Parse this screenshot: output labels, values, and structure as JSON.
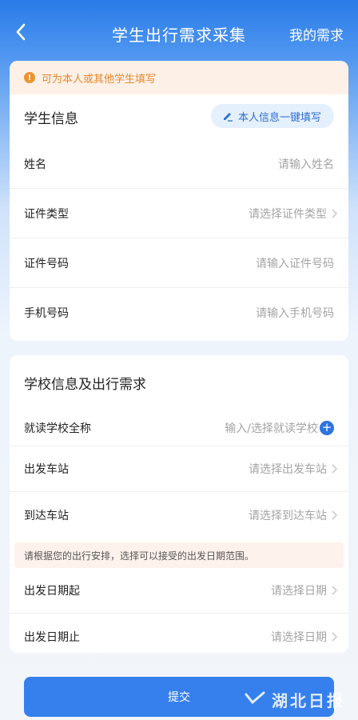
{
  "header": {
    "title": "学生出行需求采集",
    "right_link": "我的需求",
    "back_icon": "back-arrow-icon"
  },
  "student": {
    "notice": "可为本人或其他学生填写",
    "section_title": "学生信息",
    "autofill_label": "本人信息一键填写",
    "rows": [
      {
        "label": "姓名",
        "placeholder": "请输入姓名"
      },
      {
        "label": "证件类型",
        "placeholder": "请选择证件类型"
      },
      {
        "label": "证件号码",
        "placeholder": "请输入证件号码"
      },
      {
        "label": "手机号码",
        "placeholder": "请输入手机号码"
      }
    ]
  },
  "school": {
    "section_title": "学校信息及出行需求",
    "rows": [
      {
        "label": "就读学校全称",
        "placeholder": "输入/选择就读学校"
      },
      {
        "label": "出发车站",
        "placeholder": "请选择出发车站"
      },
      {
        "label": "到达车站",
        "placeholder": "请选择到达车站"
      }
    ],
    "tip": "请根据您的出行安排，选择可以接受的出发日期范围。",
    "date_rows": [
      {
        "label": "出发日期起",
        "placeholder": "请选择日期"
      },
      {
        "label": "出发日期止",
        "placeholder": "请选择日期"
      }
    ]
  },
  "submit_label": "提交",
  "watermark": "湖北日报",
  "colors": {
    "primary": "#2d74e0",
    "warning": "#e4892f",
    "placeholder": "#a4a4a4"
  }
}
